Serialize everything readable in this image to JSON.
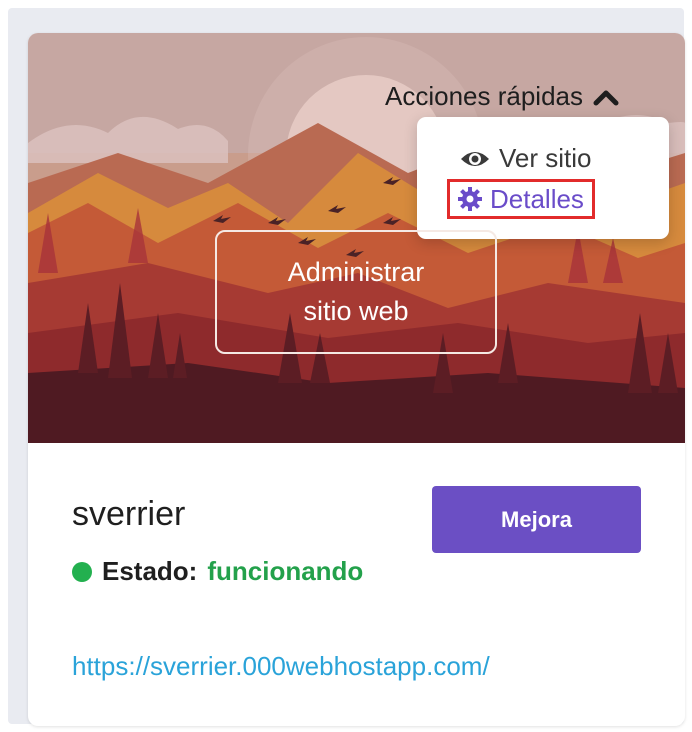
{
  "quick_actions": {
    "label": "Acciones rápidas",
    "menu": {
      "view_site": "Ver sitio",
      "details": "Detalles"
    }
  },
  "hero": {
    "manage_line1": "Administrar",
    "manage_line2": "sitio web"
  },
  "site": {
    "name": "sverrier",
    "status_label": "Estado:",
    "status_value": "funcionando",
    "url": "https://sverrier.000webhostapp.com/"
  },
  "actions": {
    "upgrade": "Mejora"
  },
  "colors": {
    "accent": "#6b4fc4",
    "status_ok": "#23b04f",
    "link": "#2aa3d9",
    "highlight": "#e22b2b"
  }
}
